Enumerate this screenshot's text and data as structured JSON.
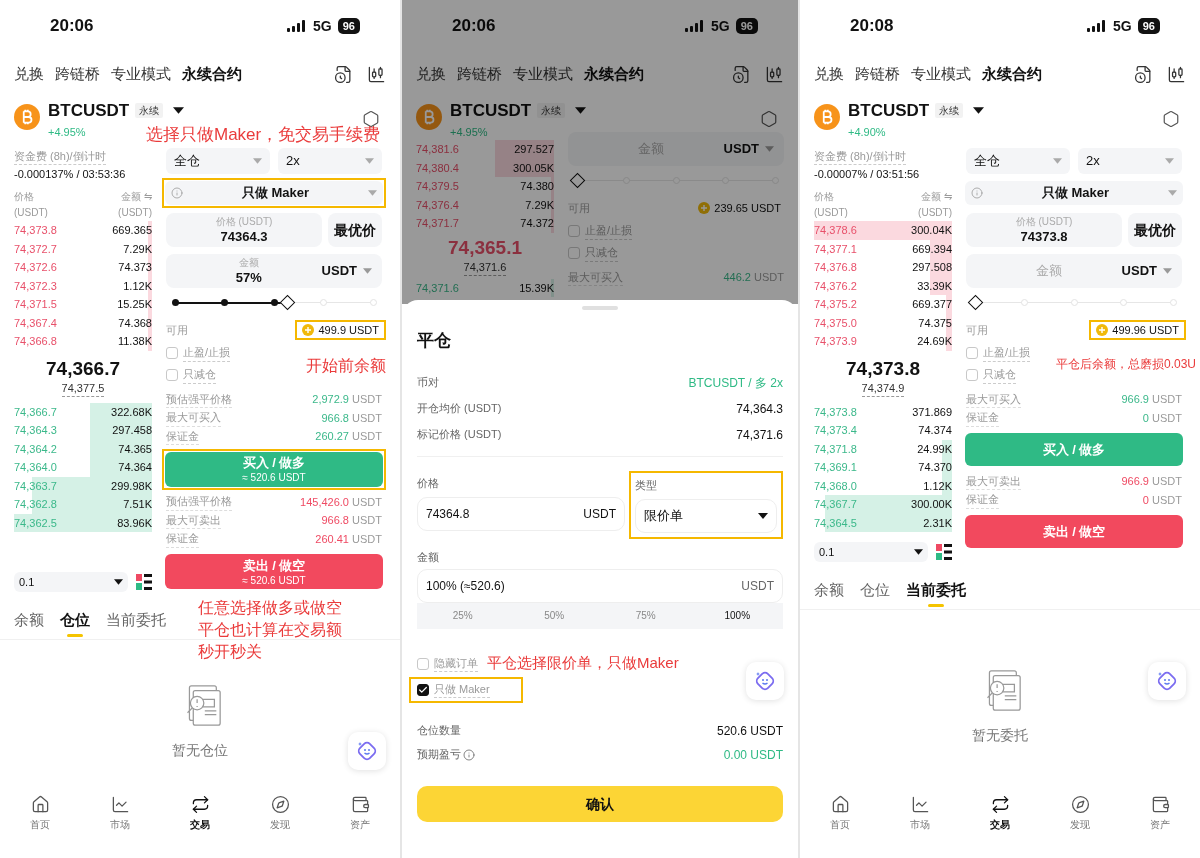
{
  "screens": [
    {
      "kind": "trade",
      "status": {
        "time": "20:06",
        "network": "5G",
        "battery": "96"
      },
      "nav_tabs": [
        {
          "label": "兑换",
          "selected": false
        },
        {
          "label": "跨链桥",
          "selected": false
        },
        {
          "label": "专业模式",
          "selected": false
        },
        {
          "label": "永续合约",
          "selected": true
        }
      ],
      "symbol": {
        "name": "BTCUSDT",
        "tag": "永续",
        "change": "+4.95%"
      },
      "funding": {
        "label": "资金费 (8h)/倒计时",
        "value": "-0.000137% / 03:53:36"
      },
      "book_header": {
        "price": "价格",
        "amount": "金额 ⇋",
        "price_unit": "(USDT)",
        "amount_unit": "(USDT)"
      },
      "asks": [
        {
          "price": "74,373.8",
          "amount": "669.365",
          "level": 0.03
        },
        {
          "price": "74,372.7",
          "amount": "7.29K",
          "level": 0.03
        },
        {
          "price": "74,372.6",
          "amount": "74.373",
          "level": 0.03
        },
        {
          "price": "74,372.3",
          "amount": "1.12K",
          "level": 0.03
        },
        {
          "price": "74,371.5",
          "amount": "15.25K",
          "level": 0.03
        },
        {
          "price": "74,367.4",
          "amount": "74.368",
          "level": 0.03
        },
        {
          "price": "74,366.8",
          "amount": "11.38K",
          "level": 0.03
        }
      ],
      "last_price": {
        "value": "74,366.7",
        "falling": false
      },
      "mark_price": "74,377.5",
      "bids": [
        {
          "price": "74,366.7",
          "amount": "322.68K",
          "level": 0.45
        },
        {
          "price": "74,364.3",
          "amount": "297.458",
          "level": 0.45
        },
        {
          "price": "74,364.2",
          "amount": "74.365",
          "level": 0.45
        },
        {
          "price": "74,364.0",
          "amount": "74.364",
          "level": 0.45
        },
        {
          "price": "74,363.7",
          "amount": "299.98K",
          "level": 0.87
        },
        {
          "price": "74,362.8",
          "amount": "7.51K",
          "level": 0.87
        },
        {
          "price": "74,362.5",
          "amount": "83.96K",
          "level": 1
        }
      ],
      "tick": "0.1",
      "form": {
        "margin_mode": "全仓",
        "leverage": "2x",
        "order_type": {
          "label": "只做 Maker",
          "highlighted": true
        },
        "price": {
          "label": "价格 (USDT)",
          "value": "74364.3"
        },
        "best_price": "最优价",
        "amount": {
          "label": "金额",
          "value": "57%",
          "unit": "USDT"
        },
        "slider": {
          "level": 0.57
        },
        "available": {
          "label": "可用",
          "value": "499.9 USDT",
          "highlighted": true
        },
        "checkboxes": [
          {
            "label": "止盈/止损",
            "checked": false
          },
          {
            "label": "只减仓",
            "checked": false
          }
        ],
        "buy_info": [
          {
            "label": "预估强平价格",
            "value": "2,972.9",
            "unit": "USDT"
          },
          {
            "label": "最大可买入",
            "value": "966.8",
            "unit": "USDT"
          },
          {
            "label": "保证金",
            "value": "260.27",
            "unit": "USDT"
          }
        ],
        "buy_button": {
          "label": "买入 / 做多",
          "sub": "≈ 520.6 USDT",
          "highlighted": true
        },
        "sell_info": [
          {
            "label": "预估强平价格",
            "value": "145,426.0",
            "unit": "USDT"
          },
          {
            "label": "最大可卖出",
            "value": "966.8",
            "unit": "USDT"
          },
          {
            "label": "保证金",
            "value": "260.41",
            "unit": "USDT"
          }
        ],
        "sell_button": {
          "label": "卖出 / 做空",
          "sub": "≈ 520.6 USDT",
          "highlighted": false
        }
      },
      "bottom_tabs": [
        {
          "label": "余额",
          "selected": false
        },
        {
          "label": "仓位",
          "selected": true
        },
        {
          "label": "当前委托",
          "selected": false
        }
      ],
      "empty_text": "暂无仓位",
      "bottom_nav": [
        {
          "label": "首页",
          "selected": false
        },
        {
          "label": "市场",
          "selected": false
        },
        {
          "label": "交易",
          "selected": true
        },
        {
          "label": "发现",
          "selected": false
        },
        {
          "label": "资产",
          "selected": false
        }
      ],
      "annotations": [
        {
          "text": "选择只做Maker，免交易手续费"
        },
        {
          "text": "开始前余额"
        },
        {
          "text": "任意选择做多或做空平仓也计算在交易额秒开秒关"
        }
      ]
    },
    {
      "kind": "close_sheet",
      "status": {
        "time": "20:06",
        "network": "5G",
        "battery": "96"
      },
      "nav_tabs": [
        {
          "label": "兑换",
          "selected": false
        },
        {
          "label": "跨链桥",
          "selected": false
        },
        {
          "label": "专业模式",
          "selected": false
        },
        {
          "label": "永续合约",
          "selected": true
        }
      ],
      "symbol": {
        "name": "BTCUSDT",
        "tag": "永续",
        "change": "+4.95%"
      },
      "asks": [
        {
          "price": "74,381.6",
          "amount": "297.527",
          "level": 0.43
        },
        {
          "price": "74,380.4",
          "amount": "300.05K",
          "level": 0.43
        },
        {
          "price": "74,379.5",
          "amount": "74.380",
          "level": 0.02
        },
        {
          "price": "74,376.4",
          "amount": "7.29K",
          "level": 0.02
        },
        {
          "price": "74,371.7",
          "amount": "74.372",
          "level": 0.02
        }
      ],
      "last_price": {
        "value": "74,365.1",
        "falling": true
      },
      "mark_price": "74,371.6",
      "bids": [
        {
          "price": "74,371.6",
          "amount": "15.39K",
          "level": 0.02
        }
      ],
      "form": {
        "amount": {
          "placeholder": "金额",
          "unit": "USDT"
        },
        "slider": {
          "level": 0
        },
        "available": {
          "label": "可用",
          "value": "239.65 USDT",
          "highlighted": false
        },
        "checkboxes": [
          {
            "label": "止盈/止损",
            "checked": false
          },
          {
            "label": "只减仓",
            "checked": false
          }
        ],
        "buy_info": [
          {
            "label": "最大可买入",
            "value": "446.2",
            "unit": "USDT"
          }
        ]
      },
      "sheet": {
        "title": "平仓",
        "details": [
          {
            "label": "币对",
            "value": "BTCUSDT / 多 2x",
            "positive": true
          },
          {
            "label": "开仓均价 (USDT)",
            "value": "74,364.3",
            "positive": false
          },
          {
            "label": "标记价格 (USDT)",
            "value": "74,371.6",
            "positive": false
          }
        ],
        "price": {
          "label": "价格",
          "value": "74364.8",
          "unit": "USDT"
        },
        "type": {
          "label": "类型",
          "value": "限价单",
          "highlighted": true
        },
        "amount": {
          "label": "金额",
          "value": "100% (≈520.6)",
          "unit": "USDT"
        },
        "presets": [
          {
            "label": "25%",
            "selected": false
          },
          {
            "label": "50%",
            "selected": false
          },
          {
            "label": "75%",
            "selected": false
          },
          {
            "label": "100%",
            "selected": true
          }
        ],
        "checkboxes": [
          {
            "label": "隐藏订单",
            "checked": false,
            "highlighted": false
          },
          {
            "label": "只做 Maker",
            "checked": true,
            "highlighted": true
          }
        ],
        "annotation": "平仓选择限价单，只做Maker",
        "summary": [
          {
            "label": "仓位数量",
            "value": "520.6 USDT",
            "positive": false,
            "info": false
          },
          {
            "label": "预期盈亏",
            "value": "0.00 USDT",
            "positive": true,
            "info": true
          }
        ],
        "confirm": "确认"
      }
    },
    {
      "kind": "trade",
      "status": {
        "time": "20:08",
        "network": "5G",
        "battery": "96"
      },
      "nav_tabs": [
        {
          "label": "兑换",
          "selected": false
        },
        {
          "label": "跨链桥",
          "selected": false
        },
        {
          "label": "专业模式",
          "selected": false
        },
        {
          "label": "永续合约",
          "selected": true
        }
      ],
      "symbol": {
        "name": "BTCUSDT",
        "tag": "永续",
        "change": "+4.90%"
      },
      "funding": {
        "label": "资金费 (8h)/倒计时",
        "value": "-0.00007% / 03:51:56"
      },
      "book_header": {
        "price": "价格",
        "amount": "金额 ⇋",
        "price_unit": "(USDT)",
        "amount_unit": "(USDT)"
      },
      "asks": [
        {
          "price": "74,378.6",
          "amount": "300.04K",
          "level": 1
        },
        {
          "price": "74,377.1",
          "amount": "669.394",
          "level": 0.16
        },
        {
          "price": "74,376.8",
          "amount": "297.508",
          "level": 0.16
        },
        {
          "price": "74,376.2",
          "amount": "33.39K",
          "level": 0.16
        },
        {
          "price": "74,375.2",
          "amount": "669.377",
          "level": 0.04
        },
        {
          "price": "74,375.0",
          "amount": "74.375",
          "level": 0.04
        },
        {
          "price": "74,373.9",
          "amount": "24.69K",
          "level": 0.04
        }
      ],
      "last_price": {
        "value": "74,373.8",
        "falling": false
      },
      "mark_price": "74,374.9",
      "bids": [
        {
          "price": "74,373.8",
          "amount": "371.869"
        },
        {
          "price": "74,373.4",
          "amount": "74.374"
        },
        {
          "price": "74,371.8",
          "amount": "24.99K",
          "level": 0.07
        },
        {
          "price": "74,369.1",
          "amount": "74.370",
          "level": 0.07
        },
        {
          "price": "74,368.0",
          "amount": "1.12K",
          "level": 0.07
        },
        {
          "price": "74,367.7",
          "amount": "300.00K",
          "level": 0.92
        },
        {
          "price": "74,364.5",
          "amount": "2.31K",
          "level": 0.92
        }
      ],
      "tick": "0.1",
      "form": {
        "margin_mode": "全仓",
        "leverage": "2x",
        "order_type": {
          "label": "只做 Maker",
          "highlighted": false
        },
        "price": {
          "label": "价格 (USDT)",
          "value": "74373.8"
        },
        "best_price": "最优价",
        "amount": {
          "placeholder": "金额",
          "unit": "USDT"
        },
        "slider": {
          "level": 0
        },
        "available": {
          "label": "可用",
          "value": "499.96 USDT",
          "highlighted": true
        },
        "checkboxes": [
          {
            "label": "止盈/止损",
            "checked": false
          },
          {
            "label": "只减仓",
            "checked": false
          }
        ],
        "buy_info": [
          {
            "label": "最大可买入",
            "value": "966.9",
            "unit": "USDT"
          },
          {
            "label": "保证金",
            "value": "0",
            "unit": "USDT"
          }
        ],
        "buy_button": {
          "label": "买入 / 做多",
          "highlighted": false
        },
        "sell_info": [
          {
            "label": "最大可卖出",
            "value": "966.9",
            "unit": "USDT"
          },
          {
            "label": "保证金",
            "value": "0",
            "unit": "USDT"
          }
        ],
        "sell_button": {
          "label": "卖出 / 做空",
          "highlighted": false
        }
      },
      "bottom_tabs": [
        {
          "label": "余额",
          "selected": false
        },
        {
          "label": "仓位",
          "selected": false
        },
        {
          "label": "当前委托",
          "selected": true
        }
      ],
      "empty_text": "暂无委托",
      "bottom_nav": [
        {
          "label": "首页",
          "selected": false
        },
        {
          "label": "市场",
          "selected": false
        },
        {
          "label": "交易",
          "selected": true
        },
        {
          "label": "发现",
          "selected": false
        },
        {
          "label": "资产",
          "selected": false
        }
      ],
      "annotations": [
        {
          "text": "平仓后余额，总磨损0.03U"
        }
      ]
    }
  ]
}
